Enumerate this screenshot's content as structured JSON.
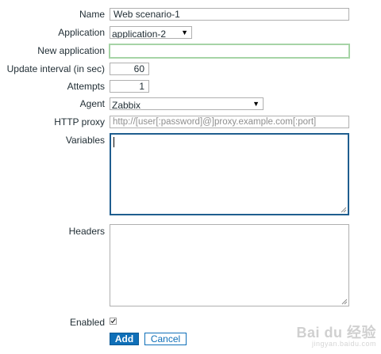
{
  "form": {
    "name_label": "Name",
    "name_value": "Web scenario-1",
    "application_label": "Application",
    "application_selected": "application-2",
    "new_application_label": "New application",
    "new_application_value": "",
    "update_interval_label": "Update interval (in sec)",
    "update_interval_value": "60",
    "attempts_label": "Attempts",
    "attempts_value": "1",
    "agent_label": "Agent",
    "agent_selected": "Zabbix",
    "http_proxy_label": "HTTP proxy",
    "http_proxy_placeholder": "http://[user[:password]@]proxy.example.com[:port]",
    "variables_label": "Variables",
    "headers_label": "Headers",
    "enabled_label": "Enabled",
    "enabled_checked": true
  },
  "buttons": {
    "add_label": "Add",
    "cancel_label": "Cancel"
  },
  "watermark": {
    "brand": "Bai du 经验",
    "url": "jingyan.baidu.com"
  },
  "colors": {
    "primary": "#0f6fb8",
    "focus_border": "#a6d4a6",
    "active_border": "#1f5e8f"
  }
}
